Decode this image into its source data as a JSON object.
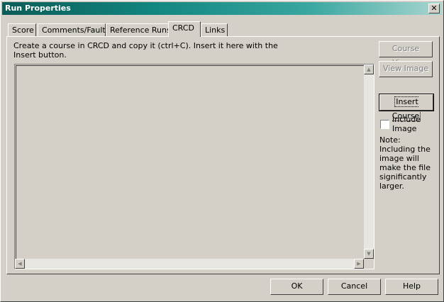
{
  "window": {
    "title": "Run Properties",
    "close_label": "✕"
  },
  "tabs": [
    {
      "label": "Score"
    },
    {
      "label": "Comments/Faults"
    },
    {
      "label": "Reference Runs"
    },
    {
      "label": "CRCD",
      "active": true
    },
    {
      "label": "Links"
    }
  ],
  "crcd": {
    "instructions": "Create a course in CRCD and copy it (ctrl+C). Insert it here with the Insert button.",
    "course_text": "",
    "course_viewer_label": "Course Viewer",
    "view_image_label": "View Image",
    "insert_course_label": "Insert Course",
    "include_image_label": "Include Image",
    "include_image_checked": false,
    "note": "Note: Including the image will make the file significantly larger."
  },
  "footer": {
    "ok_label": "OK",
    "cancel_label": "Cancel",
    "help_label": "Help"
  },
  "colors": {
    "dialog_bg": "#d4d0c8",
    "title_start": "#0c5c58",
    "title_end": "#a8d6d0"
  }
}
